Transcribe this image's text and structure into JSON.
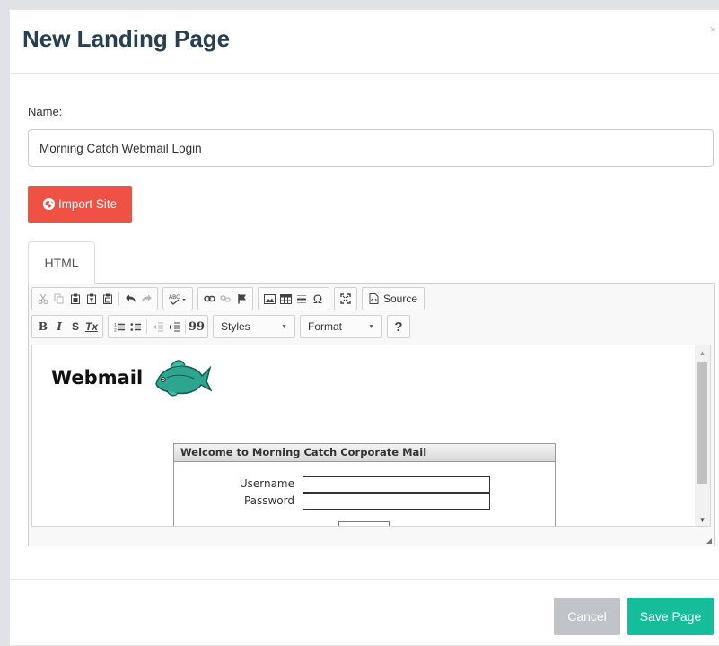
{
  "modal": {
    "title": "New Landing Page",
    "close": "×"
  },
  "form": {
    "name_label": "Name:",
    "name_value": "Morning Catch Webmail Login",
    "import_label": "Import Site"
  },
  "tabs": [
    {
      "label": "HTML",
      "active": true
    }
  ],
  "editor": {
    "toolbar": {
      "source_label": "Source",
      "styles_label": "Styles",
      "format_label": "Format",
      "help_label": "?",
      "bold": "B",
      "italic": "I",
      "strike": "S",
      "remove_format": "Tx",
      "blockquote": "99"
    },
    "preview": {
      "logo_text": "Webmail",
      "box_title": "Welcome to Morning Catch Corporate Mail",
      "username_label": "Username",
      "password_label": "Password"
    }
  },
  "footer": {
    "cancel_label": "Cancel",
    "save_label": "Save Page"
  },
  "colors": {
    "title": "#283f50",
    "import_button": "#ef5245",
    "save_button": "#16bd9a",
    "cancel_button": "#c0c4c8"
  }
}
